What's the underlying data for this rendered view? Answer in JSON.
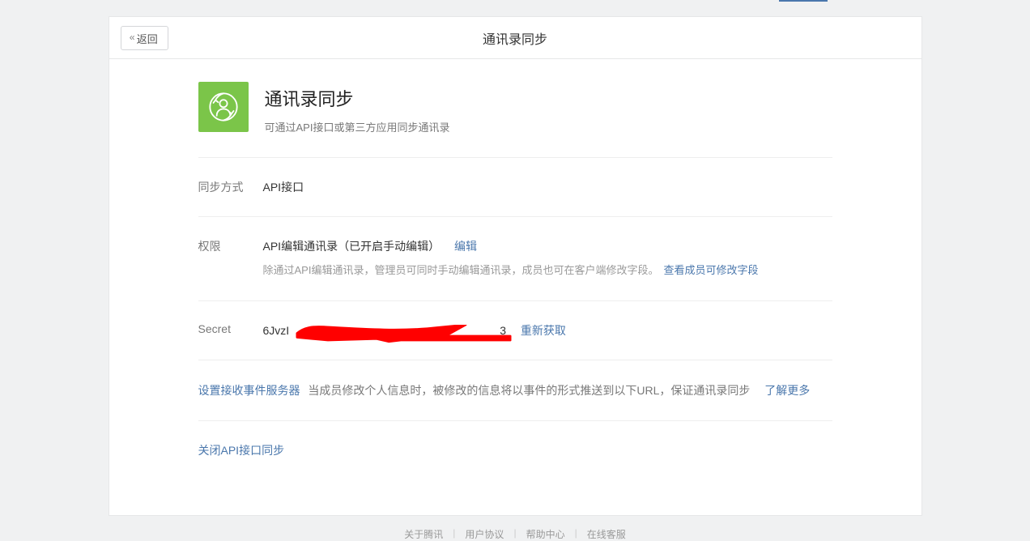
{
  "header": {
    "back_label": "返回",
    "title": "通讯录同步"
  },
  "app": {
    "title": "通讯录同步",
    "desc": "可通过API接口或第三方应用同步通讯录"
  },
  "rows": {
    "sync_method": {
      "label": "同步方式",
      "value": "API接口"
    },
    "permission": {
      "label": "权限",
      "value": "API编辑通讯录（已开启手动编辑）",
      "edit_link": "编辑",
      "sub": "除通过API编辑通讯录，管理员可同时手动编辑通讯录，成员也可在客户端修改字段。",
      "fields_link": "查看成员可修改字段"
    },
    "secret": {
      "label": "Secret",
      "value_prefix": "6JvzI",
      "value_suffix": "3",
      "reget_link": "重新获取"
    }
  },
  "event": {
    "setup_link": "设置接收事件服务器",
    "desc": "当成员修改个人信息时，被修改的信息将以事件的形式推送到以下URL，保证通讯录同步",
    "learn_more": "了解更多"
  },
  "close_api": {
    "label": "关闭API接口同步"
  },
  "footer": {
    "items": [
      "关于腾讯",
      "用户协议",
      "帮助中心",
      "在线客服"
    ]
  }
}
